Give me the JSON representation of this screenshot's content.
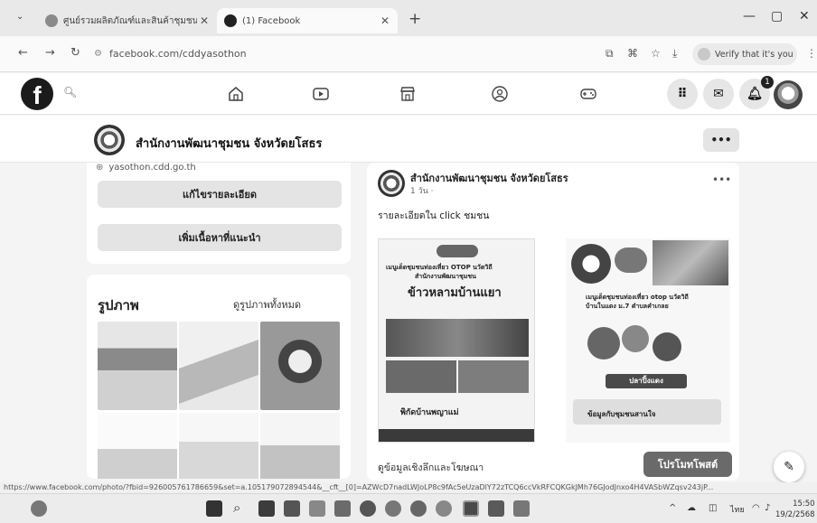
{
  "browser": {
    "tabs": [
      {
        "label": "ศูนย์รวมผลิตภัณฑ์และสินค้าชุมชน",
        "active": false
      },
      {
        "label": "(1) Facebook",
        "active": true
      }
    ],
    "url": "facebook.com/cddyasothon",
    "verify_label": "Verify that it's you",
    "status_url": "https://www.facebook.com/photo/?fbid=926005761786659&set=a.105179072894544&__cft__[0]=AZWcD7nadLWJoLP8c9fAc5eUzaDlY72zTCQ6ccVkRFCQKGkJMh76GJodJnxo4H4VASbWZqsv243jP..."
  },
  "facebook": {
    "logo": "f",
    "notification_count": "1"
  },
  "page_header": {
    "name": "สำนักงานพัฒนาชุมชน จังหวัดยโสธร",
    "more": "•••"
  },
  "intro": {
    "website": "yasothon.cdd.go.th",
    "edit_details": "แก้ไขรายละเอียด",
    "add_featured": "เพิ่มเนื้อหาที่แนะนำ"
  },
  "photos": {
    "heading": "รูปภาพ",
    "see_all": "ดูรูปภาพทั้งหมด"
  },
  "post": {
    "author": "สำนักงานพัฒนาชุมชน จังหวัดยโสธร",
    "time": "1 วัน ·",
    "text": "รายละเอียดใน click ชมชน",
    "more": "•••",
    "poster1": {
      "line1": "เมนูเด็ดชุมชนท่องเที่ยว OTOP นวัตวิถี",
      "line2": "สำนักงานพัฒนาชุมชน",
      "title": "ข้าวหลามบ้านแยา",
      "footer": "พิกัดบ้านพญาแม่"
    },
    "poster2": {
      "line1": "เมนูเด็ดชุมชนท่องเที่ยว otop นวัตวิถี",
      "line2": "บ้านในแดง ม.7 ตำบลคำเกลย",
      "label": "ปลาปิ้งแดง",
      "footer": "ข้อมูลกับชุมชนสานใจ"
    },
    "insights": "ดูข้อมูลเชิงลึกและโฆษณา",
    "promote": "โปรโมทโพสต์"
  },
  "taskbar": {
    "time": "15:50",
    "date": "19/2/2568",
    "lang": "ไทย"
  },
  "colors": {
    "fb_bg": "#ffffff",
    "page_bg": "#f0f2f5",
    "button_gray": "#e4e4e4",
    "promote_bg": "#6a6a6a"
  }
}
